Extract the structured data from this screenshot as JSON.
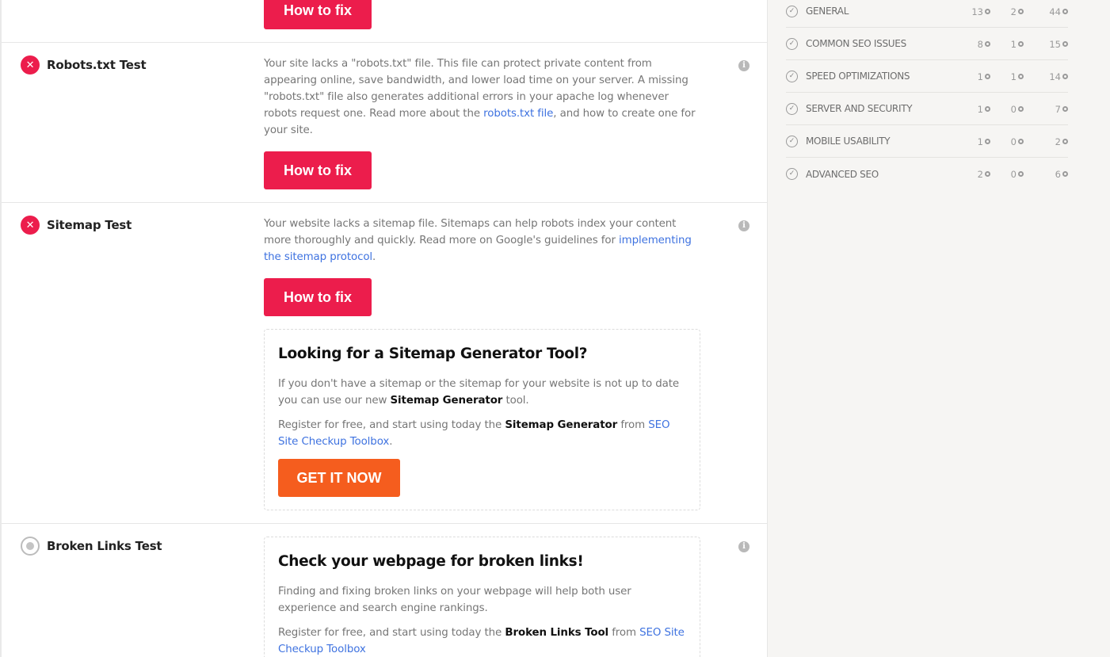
{
  "how_to_fix_label": "How to fix",
  "info_glyph": "i",
  "fail_glyph": "✕",
  "tests": {
    "robots": {
      "title": "Robots.txt Test",
      "desc_1": "Your site lacks a \"robots.txt\" file. This file can protect private content from appearing online, save bandwidth, and lower load time on your server. A missing \"robots.txt\" file also generates additional errors in your apache log whenever robots request one. Read more about the ",
      "link": "robots.txt file",
      "desc_2": ", and how to create one for your site."
    },
    "sitemap": {
      "title": "Sitemap Test",
      "desc_1": "Your website lacks a sitemap file. Sitemaps can help robots index your content more thoroughly and quickly. Read more on Google's guidelines for ",
      "link": "implementing the sitemap protocol",
      "desc_2": ".",
      "promo": {
        "title": "Looking for a Sitemap Generator Tool?",
        "p1_a": "If you don't have a sitemap or the sitemap for your website is not up to date you can use our new ",
        "p1_bold": "Sitemap Generator",
        "p1_b": " tool.",
        "p2_a": "Register for free, and start using today the ",
        "p2_bold": "Sitemap Generator",
        "p2_b": " from ",
        "p2_link": "SEO Site Checkup Toolbox",
        "p2_c": ".",
        "button": "GET IT NOW"
      }
    },
    "broken_links": {
      "title": "Broken Links Test",
      "promo": {
        "title": "Check your webpage for broken links!",
        "p1": "Finding and fixing broken links on your webpage will help both user experience and search engine rankings.",
        "p2_a": "Register for free, and start using today the ",
        "p2_bold": "Broken Links Tool",
        "p2_b": " from  ",
        "p2_link": "SEO Site Checkup Toolbox"
      }
    }
  },
  "categories": [
    {
      "name": "GENERAL",
      "failed": "13",
      "warnings": "2",
      "passed": "44"
    },
    {
      "name": "COMMON SEO ISSUES",
      "failed": "8",
      "warnings": "1",
      "passed": "15"
    },
    {
      "name": "SPEED OPTIMIZATIONS",
      "failed": "1",
      "warnings": "1",
      "passed": "14"
    },
    {
      "name": "SERVER AND SECURITY",
      "failed": "1",
      "warnings": "0",
      "passed": "7"
    },
    {
      "name": "MOBILE USABILITY",
      "failed": "1",
      "warnings": "0",
      "passed": "2"
    },
    {
      "name": "ADVANCED SEO",
      "failed": "2",
      "warnings": "0",
      "passed": "6"
    }
  ],
  "colors": {
    "fail": "#ec1d4c",
    "warning": "#f4b400",
    "pass": "#2cb54a",
    "link": "#3e72e0",
    "get_button": "#f55d1e"
  }
}
